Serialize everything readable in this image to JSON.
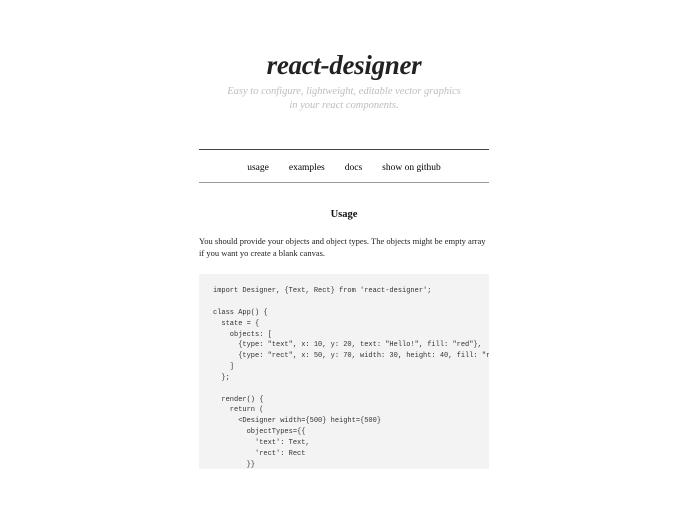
{
  "header": {
    "title": "react-designer",
    "subtitle_line1": "Easy to configure, lightweight, editable vector graphics",
    "subtitle_line2": "in your react components."
  },
  "nav": {
    "items": [
      {
        "label": "usage"
      },
      {
        "label": "examples"
      },
      {
        "label": "docs"
      },
      {
        "label": "show on github"
      }
    ]
  },
  "section": {
    "title": "Usage",
    "body": "You should provide your objects and object types. The objects might be empty array if you want yo create a blank canvas."
  },
  "code": "import Designer, {Text, Rect} from 'react-designer';\n\nclass App() {\n  state = {\n    objects: [\n      {type: \"text\", x: 10, y: 20, text: \"Hello!\", fill: \"red\"},\n      {type: \"rect\", x: 50, y: 70, width: 30, height: 40, fill: \"red\"}\n    ]\n  };\n\n  render() {\n    return (\n      <Designer width={500} height={500}\n        objectTypes={{\n          'text': Text,\n          'rect': Rect\n        }}\n        onUpdate={(objects) => this.setState({objects})}\n        objects={this.state.objects} />\n    )\n  }\n}"
}
